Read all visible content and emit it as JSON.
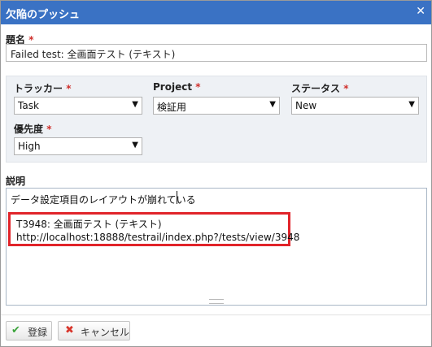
{
  "dialog": {
    "title": "欠陥のプッシュ",
    "close_glyph": "✕"
  },
  "form": {
    "subject": {
      "label": "題名",
      "required_mark": "*",
      "value": "Failed test: 全画面テスト (テキスト)"
    },
    "tracker": {
      "label": "トラッカー",
      "required_mark": "*",
      "value": "Task"
    },
    "project": {
      "label": "Project",
      "required_mark": "*",
      "value": "検証用"
    },
    "status": {
      "label": "ステータス",
      "required_mark": "*",
      "value": "New"
    },
    "priority": {
      "label": "優先度",
      "required_mark": "*",
      "value": "High"
    },
    "description": {
      "label": "説明",
      "typed_line": "データ設定項目のレイアウトが崩れている",
      "ref_line1": "T3948: 全画面テスト (テキスト)",
      "ref_line2": "http://localhost:18888/testrail/index.php?/tests/view/3948"
    }
  },
  "buttons": {
    "submit": {
      "label": "登録",
      "icon": "check-icon"
    },
    "cancel": {
      "label": "キャンセル",
      "icon": "x-icon"
    }
  },
  "icons": {
    "dropdown": "▼",
    "check": "✔",
    "cross": "✖"
  },
  "colors": {
    "titlebar": "#3a72c4",
    "required": "#d0312d",
    "highlight": "#e1242a",
    "check": "#3aa33a",
    "cross": "#d8352b"
  }
}
